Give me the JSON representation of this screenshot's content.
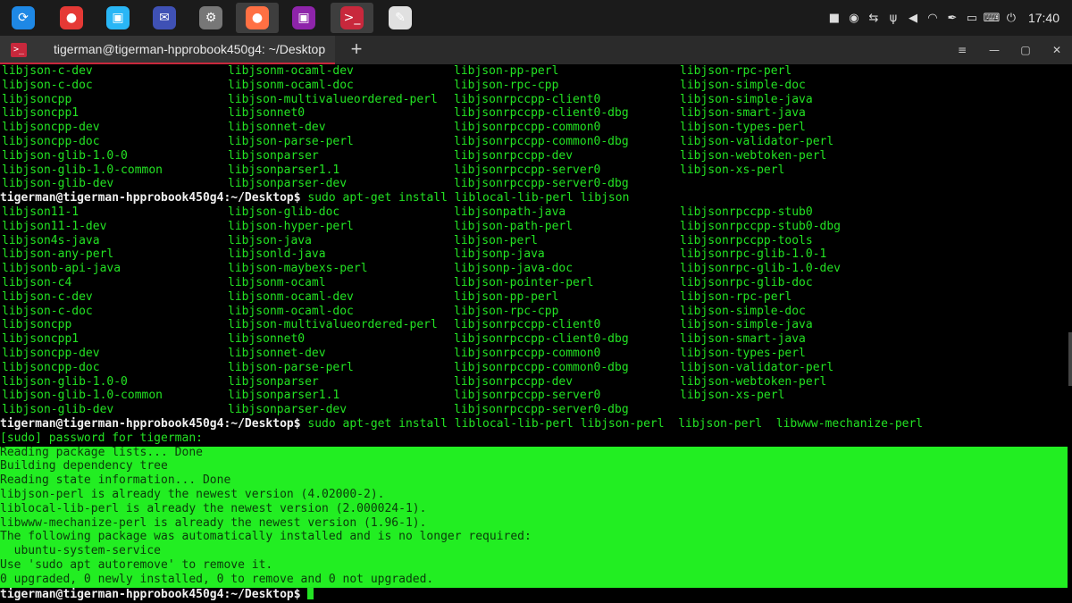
{
  "panel": {
    "launchers": [
      {
        "icon": "app-launcher-icon",
        "color": "#1e88e5",
        "glyph": "⟳"
      },
      {
        "icon": "recorder-icon",
        "color": "#e53935",
        "glyph": "●"
      },
      {
        "icon": "store-icon",
        "color": "#29b6f6",
        "glyph": "▣"
      },
      {
        "icon": "thunderbird-icon",
        "color": "#3f51b5",
        "glyph": "✉"
      },
      {
        "icon": "settings-gear-icon",
        "color": "#777777",
        "glyph": "⚙"
      },
      {
        "icon": "firefox-icon",
        "color": "#ff7043",
        "glyph": "●"
      },
      {
        "icon": "screen-recorder-icon",
        "color": "#8e24aa",
        "glyph": "▣"
      },
      {
        "icon": "terminal-icon",
        "color": "#c8283c",
        "glyph": ">_"
      },
      {
        "icon": "text-editor-icon",
        "color": "#e0e0e0",
        "glyph": "✎"
      }
    ],
    "clock": "17:40"
  },
  "window": {
    "tab_title": "tigerman@tigerman-hpprobook450g4: ~/Desktop",
    "new_tab": "+",
    "menu": "≡",
    "minimize": "—",
    "maximize": "▢",
    "close": "✕"
  },
  "terminal": {
    "prompt_user": "tigerman@tigerman-hpprobook450g4",
    "prompt_path": ":~/Desktop",
    "prompt_sep": "$",
    "block1": [
      [
        "libjson-c-dev",
        "libjsonm-ocaml-dev",
        "libjson-pp-perl",
        "libjson-rpc-perl"
      ],
      [
        "libjson-c-doc",
        "libjsonm-ocaml-doc",
        "libjson-rpc-cpp",
        "libjson-simple-doc"
      ],
      [
        "libjsoncpp",
        "libjson-multivalueordered-perl",
        "libjsonrpccpp-client0",
        "libjson-simple-java"
      ],
      [
        "libjsoncpp1",
        "libjsonnet0",
        "libjsonrpccpp-client0-dbg",
        "libjson-smart-java"
      ],
      [
        "libjsoncpp-dev",
        "libjsonnet-dev",
        "libjsonrpccpp-common0",
        "libjson-types-perl"
      ],
      [
        "libjsoncpp-doc",
        "libjson-parse-perl",
        "libjsonrpccpp-common0-dbg",
        "libjson-validator-perl"
      ],
      [
        "libjson-glib-1.0-0",
        "libjsonparser",
        "libjsonrpccpp-dev",
        "libjson-webtoken-perl"
      ],
      [
        "libjson-glib-1.0-common",
        "libjsonparser1.1",
        "libjsonrpccpp-server0",
        "libjson-xs-perl"
      ],
      [
        "libjson-glib-dev",
        "libjsonparser-dev",
        "libjsonrpccpp-server0-dbg",
        ""
      ]
    ],
    "cmd1": " sudo apt-get install liblocal-lib-perl libjson",
    "block2": [
      [
        "libjson11-1",
        "libjson-glib-doc",
        "libjsonpath-java",
        "libjsonrpccpp-stub0"
      ],
      [
        "libjson11-1-dev",
        "libjson-hyper-perl",
        "libjson-path-perl",
        "libjsonrpccpp-stub0-dbg"
      ],
      [
        "libjson4s-java",
        "libjson-java",
        "libjson-perl",
        "libjsonrpccpp-tools"
      ],
      [
        "libjson-any-perl",
        "libjsonld-java",
        "libjsonp-java",
        "libjsonrpc-glib-1.0-1"
      ],
      [
        "libjsonb-api-java",
        "libjson-maybexs-perl",
        "libjsonp-java-doc",
        "libjsonrpc-glib-1.0-dev"
      ],
      [
        "libjson-c4",
        "libjsonm-ocaml",
        "libjson-pointer-perl",
        "libjsonrpc-glib-doc"
      ],
      [
        "libjson-c-dev",
        "libjsonm-ocaml-dev",
        "libjson-pp-perl",
        "libjson-rpc-perl"
      ],
      [
        "libjson-c-doc",
        "libjsonm-ocaml-doc",
        "libjson-rpc-cpp",
        "libjson-simple-doc"
      ],
      [
        "libjsoncpp",
        "libjson-multivalueordered-perl",
        "libjsonrpccpp-client0",
        "libjson-simple-java"
      ],
      [
        "libjsoncpp1",
        "libjsonnet0",
        "libjsonrpccpp-client0-dbg",
        "libjson-smart-java"
      ],
      [
        "libjsoncpp-dev",
        "libjsonnet-dev",
        "libjsonrpccpp-common0",
        "libjson-types-perl"
      ],
      [
        "libjsoncpp-doc",
        "libjson-parse-perl",
        "libjsonrpccpp-common0-dbg",
        "libjson-validator-perl"
      ],
      [
        "libjson-glib-1.0-0",
        "libjsonparser",
        "libjsonrpccpp-dev",
        "libjson-webtoken-perl"
      ],
      [
        "libjson-glib-1.0-common",
        "libjsonparser1.1",
        "libjsonrpccpp-server0",
        "libjson-xs-perl"
      ],
      [
        "libjson-glib-dev",
        "libjsonparser-dev",
        "libjsonrpccpp-server0-dbg",
        ""
      ]
    ],
    "cmd2": " sudo apt-get install liblocal-lib-perl libjson-perl  libjson-perl  libwww-mechanize-perl",
    "sudo_line": "[sudo] password for tigerman:",
    "output": [
      "Reading package lists... Done",
      "Building dependency tree",
      "Reading state information... Done",
      "libjson-perl is already the newest version (4.02000-2).",
      "liblocal-lib-perl is already the newest version (2.000024-1).",
      "libwww-mechanize-perl is already the newest version (1.96-1).",
      "The following package was automatically installed and is no longer required:",
      "  ubuntu-system-service",
      "Use 'sudo apt autoremove' to remove it.",
      "0 upgraded, 0 newly installed, 0 to remove and 0 not upgraded."
    ],
    "colors": {
      "text": "#23e223",
      "highlight": "#22ee22",
      "prompt": "#f0f0f0",
      "accent": "#c8283c"
    }
  }
}
